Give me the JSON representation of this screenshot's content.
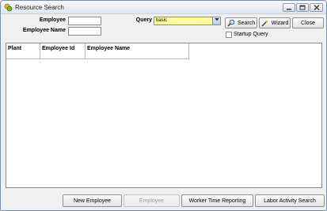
{
  "window": {
    "title": "Resource Search"
  },
  "search": {
    "employee_label": "Employee",
    "employee_value": "",
    "employee_name_label": "Employee Name",
    "employee_name_value": "",
    "query_label": "Query",
    "query_value": "basic"
  },
  "actions": {
    "search_label": "Search",
    "wizard_label": "Wizard",
    "close_label": "Close",
    "startup_query_label": "Startup Query",
    "startup_query_checked": false
  },
  "grid": {
    "columns": [
      "Plant",
      "Employee Id",
      "Employee Name"
    ],
    "rows": []
  },
  "footer": {
    "new_employee_label": "New Employee",
    "employee_label": "Employee",
    "employee_enabled": false,
    "worker_time_label": "Worker Time Reporting",
    "labor_activity_label": "Labor Activity Search"
  },
  "colors": {
    "query_highlight": "#ffff99",
    "grid_background": "#ababab"
  }
}
